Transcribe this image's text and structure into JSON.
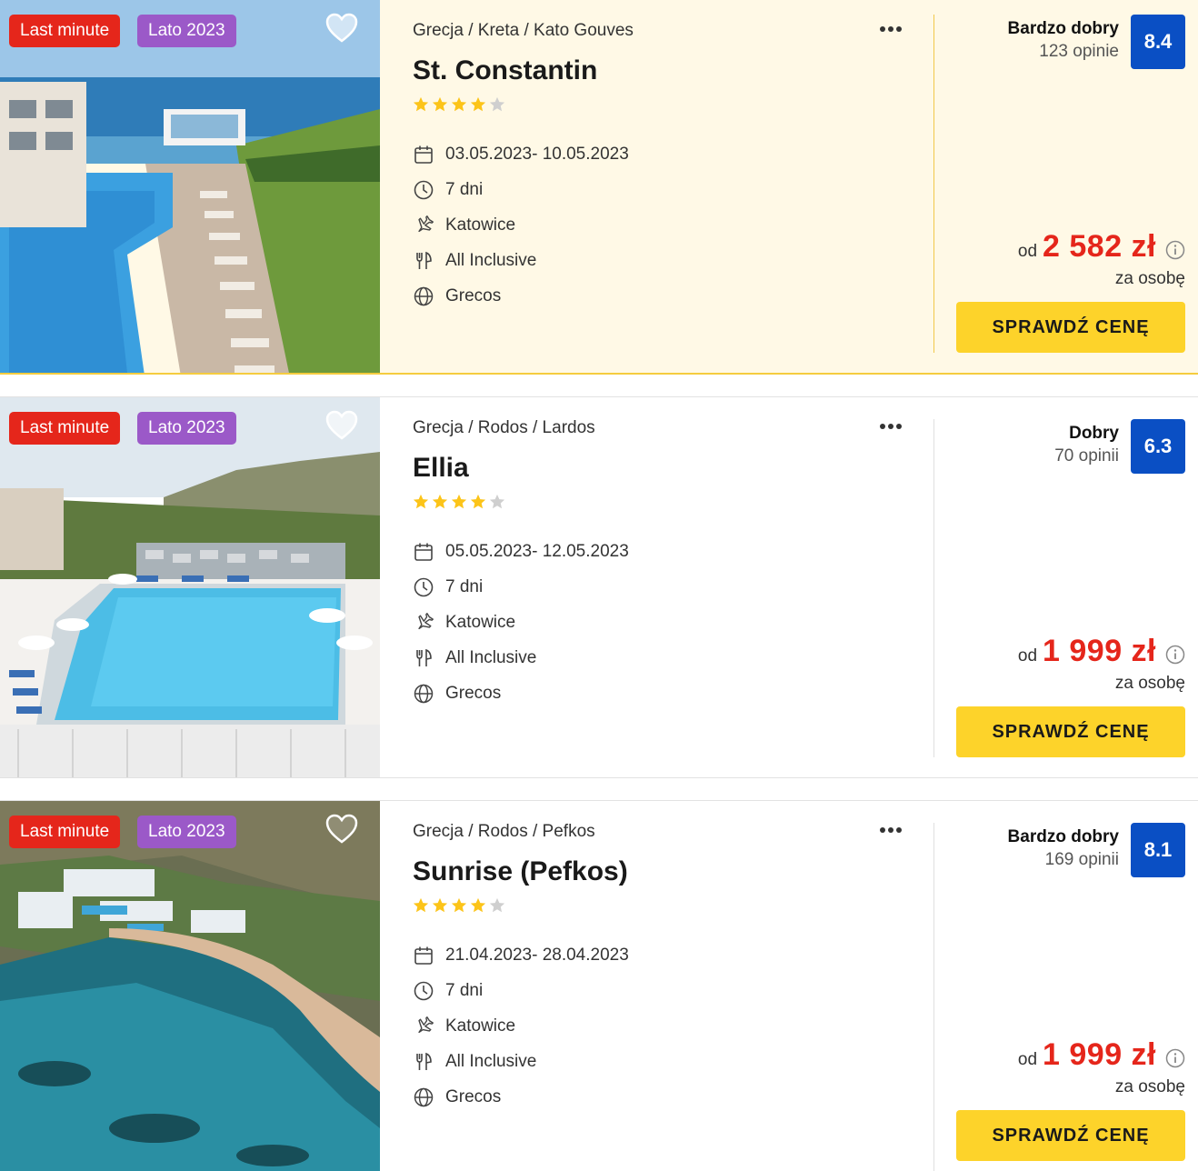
{
  "colors": {
    "last_minute": "#e5261b",
    "season": "#9b59c8",
    "score": "#0a4fc4",
    "price": "#e5261b",
    "cta": "#fdd32a",
    "star_on": "#fcc419",
    "star_off": "#cfcfcf",
    "highlight_bg": "#fff9e6"
  },
  "offers": [
    {
      "tags": {
        "last_minute": "Last minute",
        "season": "Lato 2023"
      },
      "breadcrumb": "Grecja / Kreta / Kato Gouves",
      "name": "St. Constantin",
      "stars": 4,
      "dates": "03.05.2023- 10.05.2023",
      "duration": "7 dni",
      "departure": "Katowice",
      "board": "All Inclusive",
      "operator": "Grecos",
      "rating_label": "Bardzo dobry",
      "rating_count": "123 opinie",
      "score": "8.4",
      "price_prefix": "od",
      "price": "2 582 zł",
      "per_person": "za osobę",
      "cta": "SPRAWDŹ CENĘ",
      "favorite": false,
      "highlighted": true
    },
    {
      "tags": {
        "last_minute": "Last minute",
        "season": "Lato 2023"
      },
      "breadcrumb": "Grecja / Rodos / Lardos",
      "name": "Ellia",
      "stars": 4,
      "dates": "05.05.2023- 12.05.2023",
      "duration": "7 dni",
      "departure": "Katowice",
      "board": "All Inclusive",
      "operator": "Grecos",
      "rating_label": "Dobry",
      "rating_count": "70 opinii",
      "score": "6.3",
      "price_prefix": "od",
      "price": "1 999 zł",
      "per_person": "za osobę",
      "cta": "SPRAWDŹ CENĘ",
      "favorite": false,
      "highlighted": false
    },
    {
      "tags": {
        "last_minute": "Last minute",
        "season": "Lato 2023"
      },
      "breadcrumb": "Grecja / Rodos / Pefkos",
      "name": "Sunrise (Pefkos)",
      "stars": 4,
      "dates": "21.04.2023- 28.04.2023",
      "duration": "7 dni",
      "departure": "Katowice",
      "board": "All Inclusive",
      "operator": "Grecos",
      "rating_label": "Bardzo dobry",
      "rating_count": "169 opinii",
      "score": "8.1",
      "price_prefix": "od",
      "price": "1 999 zł",
      "per_person": "za osobę",
      "cta": "SPRAWDŹ CENĘ",
      "favorite": false,
      "highlighted": false
    }
  ]
}
